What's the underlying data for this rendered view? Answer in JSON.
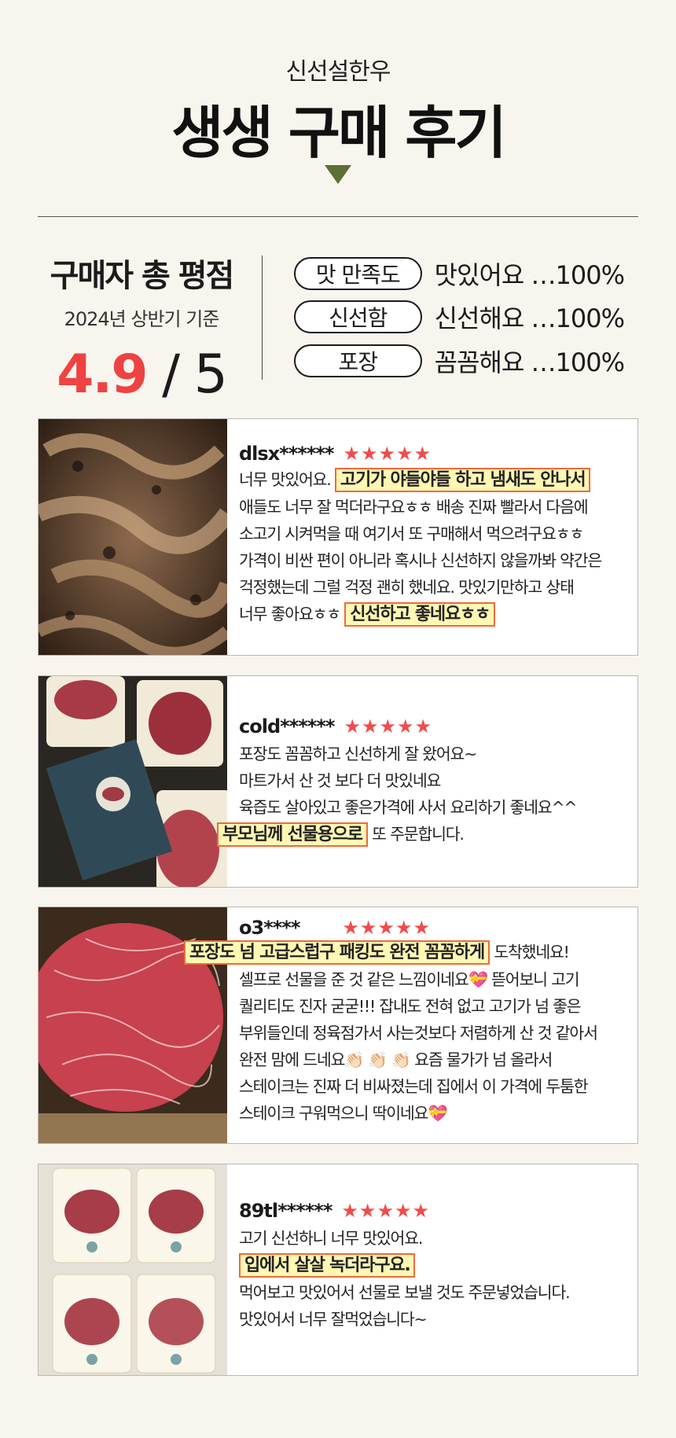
{
  "header": {
    "brand": "신선설한우",
    "title": "생생 구매 후기"
  },
  "summary": {
    "title": "구매자 총 평점",
    "period": "2024년 상반기 기준",
    "score": "4.9",
    "score_suffix": " / 5",
    "criteria": [
      {
        "label": "맛 만족도",
        "result": "맛있어요 …100%"
      },
      {
        "label": "신선함",
        "result": "신선해요 …100%"
      },
      {
        "label": "포장",
        "result": "꼼꼼해요 …100%"
      }
    ]
  },
  "colors": {
    "accent_red": "#ef4242",
    "highlight_bg": "#fff7b3",
    "highlight_border": "#ef6a3a",
    "triangle": "#5e6e35"
  },
  "reviews": [
    {
      "user": "dlsx******",
      "stars": "★★★★★",
      "lines": [
        {
          "a": "너무 맛있어요. ",
          "h": "고기가 야들야들 하고 냄새도 안나서",
          "b": ""
        },
        {
          "a": "애들도 너무 잘 먹더라구요ㅎㅎ 배송 진짜 빨라서 다음에",
          "h": "",
          "b": ""
        },
        {
          "a": "소고기 시켜먹을 때 여기서 또 구매해서 먹으려구요ㅎㅎ",
          "h": "",
          "b": ""
        },
        {
          "a": "가격이 비싼 편이 아니라 혹시나 신선하지 않을까봐 약간은",
          "h": "",
          "b": ""
        },
        {
          "a": "걱정했는데 그럴 걱정 괜히 했네요. 맛있기만하고 상태",
          "h": "",
          "b": ""
        },
        {
          "a": "너무 좋아요ㅎㅎ ",
          "h": "신선하고 좋네요ㅎㅎ",
          "b": ""
        }
      ]
    },
    {
      "user": "cold******",
      "stars": "★★★★★",
      "lines": [
        {
          "a": "포장도 꼼꼼하고 신선하게 잘 왔어요~",
          "h": "",
          "b": ""
        },
        {
          "a": "마트가서 산 것 보다 더 맛있네요",
          "h": "",
          "b": ""
        },
        {
          "a": "육즙도 살아있고 좋은가격에 사서 요리하기 좋네요^^",
          "h": "",
          "b": ""
        },
        {
          "a": "",
          "h": "부모님께 선물용으로",
          "b": " 또 주문합니다."
        }
      ]
    },
    {
      "user": "o3****",
      "stars": "★★★★★",
      "lines": [
        {
          "a": "",
          "h": "포장도 넘 고급스럽구 패킹도 완전 꼼꼼하게",
          "b": " 도착했네요!"
        },
        {
          "a": "셀프로 선물을 준 것 같은 느낌이네요💝 뜯어보니 고기",
          "h": "",
          "b": ""
        },
        {
          "a": "퀄리티도 진자 굳굳!!! 잡내도 전혀 없고 고기가 넘 좋은",
          "h": "",
          "b": ""
        },
        {
          "a": "부위들인데 정육점가서 사는것보다 저렴하게 산 것 같아서",
          "h": "",
          "b": ""
        },
        {
          "a": "완전 맘에 드네요👏🏻 👏🏻 👏🏻 요즘 물가가 넘 올라서",
          "h": "",
          "b": ""
        },
        {
          "a": "스테이크는 진짜 더 비싸졌는데 집에서 이 가격에 두툼한",
          "h": "",
          "b": ""
        },
        {
          "a": "스테이크 구워먹으니 딱이네요💝",
          "h": "",
          "b": ""
        }
      ]
    },
    {
      "user": "89tl******",
      "stars": "★★★★★",
      "lines": [
        {
          "a": "고기 신선하니 너무 맛있어요.",
          "h": "",
          "b": ""
        },
        {
          "a": "",
          "h": "입에서 살살 녹더라구요.",
          "b": ""
        },
        {
          "a": "먹어보고 맛있어서 선물로 보낼 것도 주문넣었습니다.",
          "h": "",
          "b": ""
        },
        {
          "a": "맛있어서 너무 잘먹었습니다~",
          "h": "",
          "b": ""
        }
      ]
    }
  ]
}
